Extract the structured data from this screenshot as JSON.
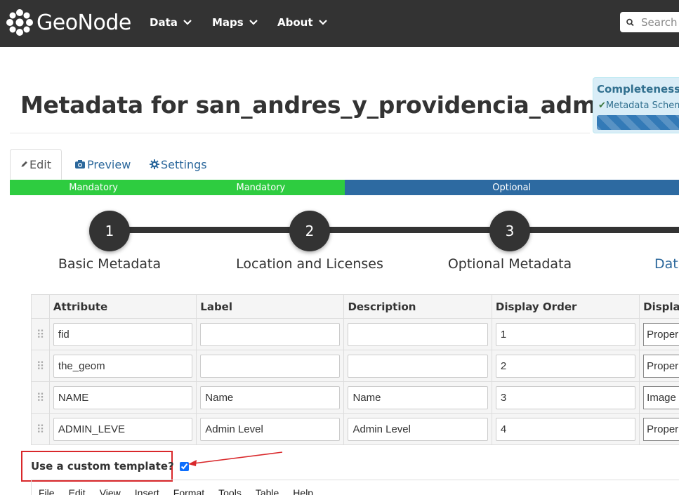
{
  "navbar": {
    "logo_text": "GeoNode",
    "menu": [
      {
        "label": "Data"
      },
      {
        "label": "Maps"
      },
      {
        "label": "About"
      }
    ],
    "search_placeholder": "Search"
  },
  "page": {
    "title": "Metadata for san_andres_y_providencia_administra…"
  },
  "completeness": {
    "title": "Completeness",
    "item": "Metadata Schem"
  },
  "tabs": [
    {
      "label": "Edit",
      "icon": "pencil-icon",
      "active": true
    },
    {
      "label": "Preview",
      "icon": "camera-icon",
      "active": false
    },
    {
      "label": "Settings",
      "icon": "gear-icon",
      "active": false
    }
  ],
  "progress_segments": [
    {
      "label": "Mandatory",
      "color": "#2ecc40"
    },
    {
      "label": "Mandatory",
      "color": "#2ecc40"
    },
    {
      "label": "Optional",
      "color": "#2d6aa1"
    }
  ],
  "steps": [
    {
      "number": "1",
      "label": "Basic Metadata"
    },
    {
      "number": "2",
      "label": "Location and Licenses"
    },
    {
      "number": "3",
      "label": "Optional Metadata"
    },
    {
      "label": "Data"
    }
  ],
  "attribute_table": {
    "columns": [
      "Attribute",
      "Label",
      "Description",
      "Display Order",
      "Display"
    ],
    "rows": [
      {
        "attribute": "fid",
        "label": "",
        "description": "",
        "order": "1",
        "display": "Proper"
      },
      {
        "attribute": "the_geom",
        "label": "",
        "description": "",
        "order": "2",
        "display": "Proper"
      },
      {
        "attribute": "NAME",
        "label": "Name",
        "description": "Name",
        "order": "3",
        "display": "Image"
      },
      {
        "attribute": "ADMIN_LEVE",
        "label": "Admin Level",
        "description": "Admin Level",
        "order": "4",
        "display": "Proper"
      }
    ]
  },
  "custom_template": {
    "label": "Use a custom template?",
    "checked": true
  },
  "editor_menu": [
    "File",
    "Edit",
    "View",
    "Insert",
    "Format",
    "Tools",
    "Table",
    "Help"
  ],
  "colors": {
    "navbar": "#333333",
    "mandatory": "#2ecc40",
    "optional": "#2d6aa1",
    "link": "#2c689c",
    "highlight_box": "#d9282b"
  }
}
